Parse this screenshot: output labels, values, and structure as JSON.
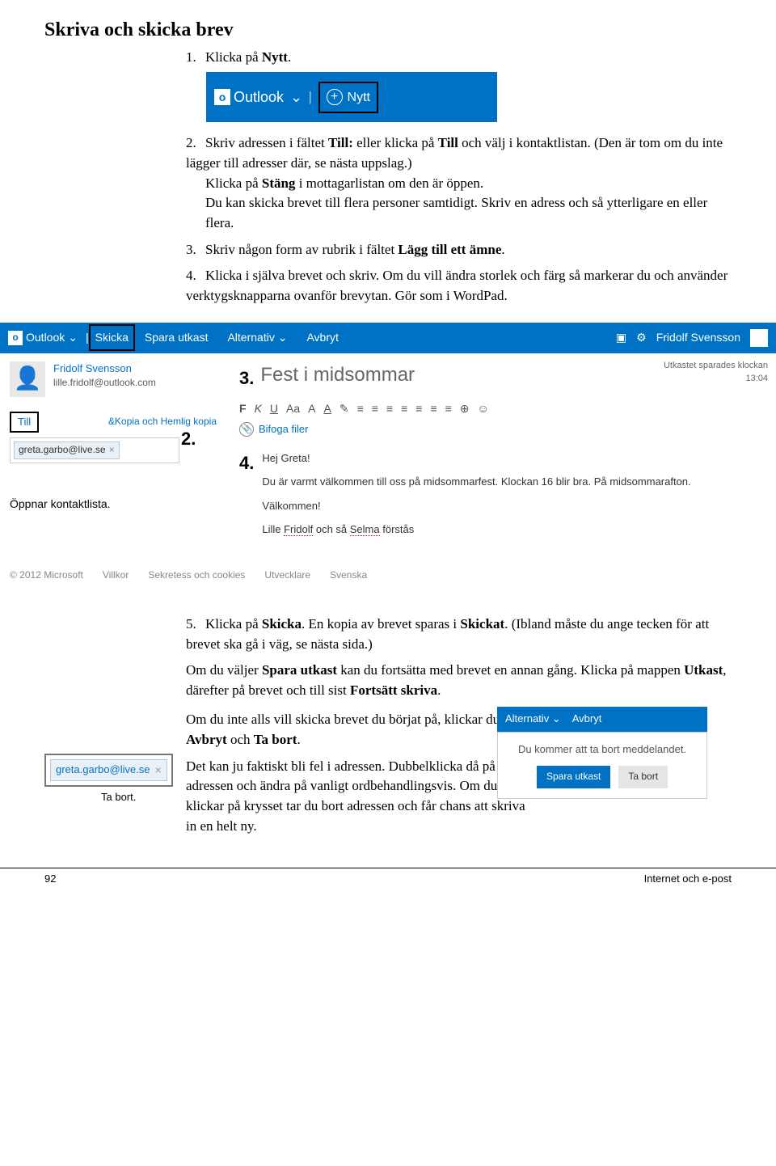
{
  "heading": "Skriva och skicka brev",
  "steps": {
    "1": {
      "num": "1.",
      "pre": "Klicka på ",
      "bold": "Nytt",
      "post": "."
    },
    "2": {
      "num": "2.",
      "pre": "Skriv adressen i fältet ",
      "b1": "Till:",
      "mid": " eller klicka på ",
      "b2": "Till",
      "post": " och välj i kontaktlistan. (Den är tom om du inte lägger till adresser där, se nästa uppslag.)",
      "line2pre": "Klicka på ",
      "line2b": "Stäng",
      "line2post": " i mottagarlistan om den är öppen.",
      "line3": "Du kan skicka brevet till flera personer samtidigt. Skriv en adress och så ytterligare en eller flera."
    },
    "3": {
      "num": "3.",
      "pre": "Skriv någon form av rubrik i fältet ",
      "bold": "Lägg till ett ämne",
      "post": "."
    },
    "4": {
      "num": "4.",
      "text": "Klicka i själva brevet och skriv. Om du vill ändra storlek och färg så markerar du och använder verktygsknapparna ovanför brevytan. Gör som i WordPad."
    },
    "5": {
      "num": "5.",
      "pre": "Klicka på ",
      "b1": "Skicka",
      "mid": ". En kopia av brevet sparas i ",
      "b2": "Skickat",
      "post": ". (Ibland måste du ange tecken för att brevet ska gå i väg, se nästa sida.)"
    }
  },
  "after5": {
    "p1pre": "Om du väljer ",
    "p1b1": "Spara utkast",
    "p1mid": " kan du fortsätta med brevet en annan gång. Klicka på mappen ",
    "p1b2": "Utkast",
    "p1mid2": ", därefter på brevet och till sist ",
    "p1b3": "Fortsätt skriva",
    "p1post": ".",
    "p2pre": "Om du inte alls vill skicka brevet du börjat på, klickar du på ",
    "p2b1": "Avbryt",
    "p2mid": " och ",
    "p2b2": "Ta bort",
    "p2post": ".",
    "p3": "Det kan ju faktiskt bli fel i adressen. Dubbelklicka då på adressen och ändra på vanligt ordbehandlingsvis. Om du klickar på krysset tar du bort adressen och får chans att skriva in en helt ny."
  },
  "callouts": {
    "2": "2.",
    "3": "3.",
    "4": "4.",
    "5": "5."
  },
  "ui": {
    "outlook": "Outlook",
    "nytt": "Nytt",
    "skicka": "Skicka",
    "spara_utkast": "Spara utkast",
    "alternativ": "Alternativ",
    "avbryt": "Avbryt",
    "user": "Fridolf Svensson",
    "user_email": "lille.fridolf@outlook.com",
    "till": "Till",
    "kopia": "&Kopia och Hemlig kopia",
    "chip": "greta.garbo@live.se",
    "open_contacts": "Öppnar kontaktlista.",
    "subject": "Fest i midsommar",
    "saved1": "Utkastet sparades klockan",
    "saved2": "13:04",
    "attach": "Bifoga filer",
    "body1": "Hej Greta!",
    "body2": "Du är varmt välkommen till oss på midsommarfest. Klockan 16 blir bra. På midsommarafton.",
    "body3": "Välkommen!",
    "body4a": "Lille ",
    "body4b": "Fridolf",
    "body4c": " och så ",
    "body4d": "Selma",
    "body4e": " förstås",
    "copyright": "© 2012 Microsoft",
    "villkor": "Villkor",
    "sekretess": "Sekretess och cookies",
    "utvecklare": "Utvecklare",
    "svenska": "Svenska",
    "fmt": [
      "F",
      "K",
      "U",
      "Aa",
      "A",
      "A",
      "✎",
      "≡",
      "≡",
      "≡",
      "≡",
      "≡",
      "≡",
      "≡",
      "⊕",
      "☺"
    ],
    "chev": "⌄"
  },
  "mini": {
    "alt": "Alternativ",
    "avb": "Avbryt",
    "msg": "Du kommer att ta bort meddelandet.",
    "btn1": "Spara utkast",
    "btn2": "Ta bort"
  },
  "tabort": "Ta bort.",
  "footer": {
    "page": "92",
    "title": "Internet och e-post"
  }
}
